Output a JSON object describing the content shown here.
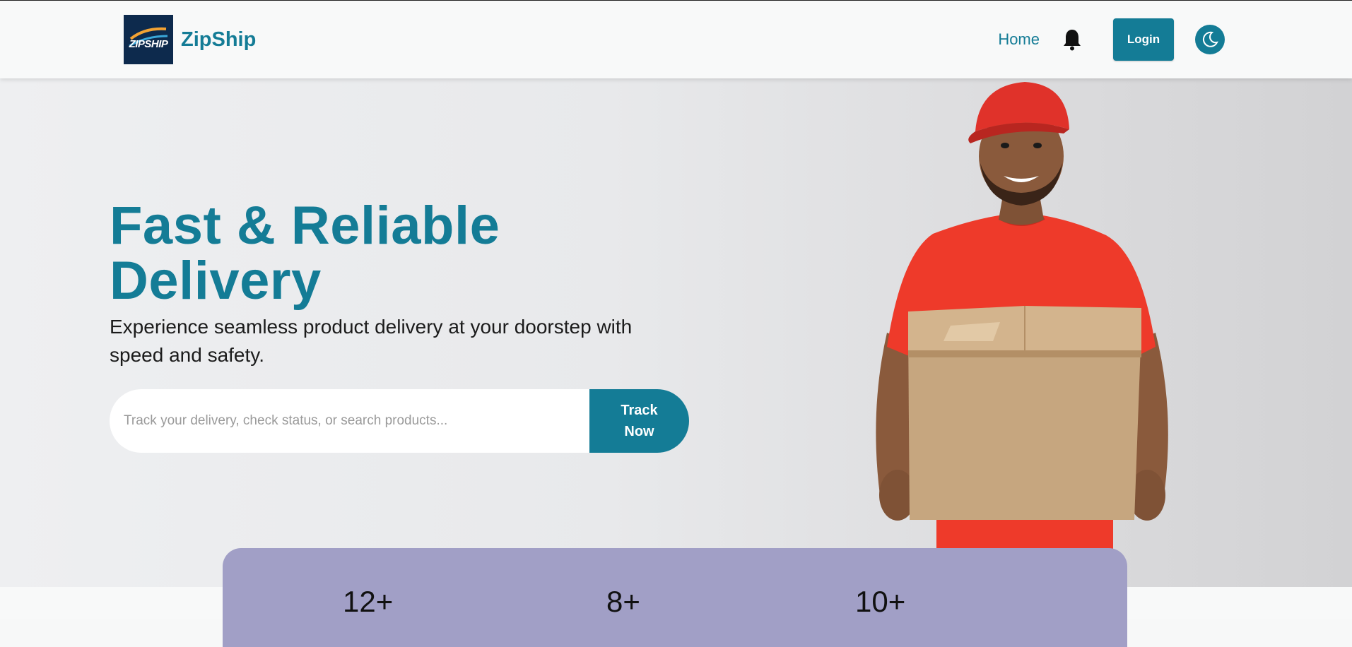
{
  "brand": {
    "name": "ZipShip",
    "logo_text": "ZIPSHIP"
  },
  "nav": {
    "home": "Home",
    "login": "Login"
  },
  "icons": {
    "bell": "bell-icon",
    "theme": "moon-icon"
  },
  "hero": {
    "title_line1": "Fast & Reliable",
    "title_line2": "Delivery",
    "subtitle": "Experience seamless product delivery at your doorstep with speed and safety.",
    "search_placeholder": "Track your delivery, check status, or search products...",
    "track_button": "Track Now"
  },
  "stats": [
    "12+",
    "8+",
    "10+"
  ],
  "colors": {
    "accent": "#147c96",
    "stats_card": "#a19fc6",
    "shirt": "#ee3a2a",
    "box": "#c6a67f"
  }
}
